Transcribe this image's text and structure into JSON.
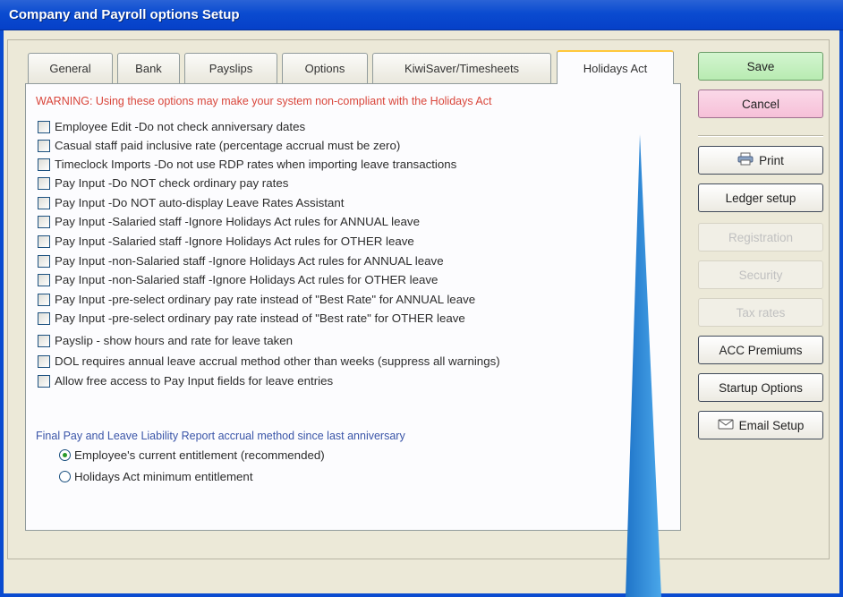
{
  "window": {
    "title": "Company and Payroll options Setup"
  },
  "tabs": [
    {
      "label": "General",
      "active": false
    },
    {
      "label": "Bank",
      "active": false
    },
    {
      "label": "Payslips",
      "active": false
    },
    {
      "label": "Options",
      "active": false
    },
    {
      "label": "KiwiSaver/Timesheets",
      "active": false
    },
    {
      "label": "Holidays Act",
      "active": true
    }
  ],
  "holidays": {
    "warning": "WARNING: Using these options may make your system non-compliant with the Holidays Act",
    "options": [
      "Employee Edit -Do not check anniversary dates",
      "Casual staff paid inclusive rate (percentage accrual must be zero)",
      "Timeclock Imports -Do not use RDP rates when importing leave transactions",
      "Pay Input -Do NOT check ordinary pay rates",
      "Pay Input -Do NOT auto-display Leave Rates Assistant",
      "Pay Input -Salaried staff -Ignore Holidays Act rules for ANNUAL leave",
      "Pay Input -Salaried staff -Ignore Holidays Act rules for OTHER leave",
      "Pay Input -non-Salaried staff -Ignore Holidays Act rules for ANNUAL leave",
      "Pay Input -non-Salaried staff -Ignore Holidays Act rules for OTHER leave",
      "Pay Input -pre-select ordinary pay rate instead of \"Best Rate\" for ANNUAL leave",
      "Pay Input -pre-select ordinary pay rate instead of \"Best rate\" for OTHER leave",
      "Payslip - show hours and rate for leave taken",
      "DOL requires annual leave accrual method other than weeks (suppress all warnings)",
      "Allow free access to Pay Input fields for leave entries"
    ],
    "accrual_label": "Final Pay and Leave Liability Report accrual method since last anniversary",
    "radio_options": [
      "Employee's current entitlement (recommended)",
      "Holidays Act minimum entitlement"
    ],
    "radio_selected": 0
  },
  "buttons": {
    "save": "Save",
    "cancel": "Cancel",
    "print": "Print",
    "ledger_setup": "Ledger setup",
    "registration": "Registration",
    "security": "Security",
    "tax_rates": "Tax rates",
    "acc_premiums": "ACC Premiums",
    "startup_options": "Startup Options",
    "email_setup": "Email Setup"
  },
  "icons": {
    "print": "printer-icon",
    "email": "email-icon"
  },
  "colors": {
    "titlebar": "#0a4bd0",
    "warning": "#d9463b",
    "section_label": "#3a55a8",
    "save_bg": "#c5f0c0",
    "cancel_bg": "#f8cde0",
    "pointer": "#2f8fd8"
  }
}
